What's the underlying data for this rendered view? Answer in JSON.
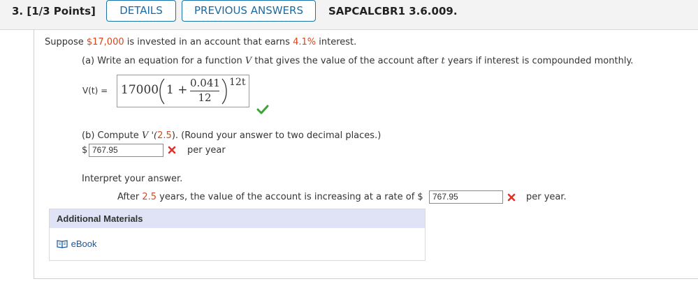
{
  "header": {
    "question_label": "3. [1/3 Points]",
    "details_button": "DETAILS",
    "previous_answers_button": "PREVIOUS ANSWERS",
    "problem_code": "SAPCALCBR1 3.6.009."
  },
  "problem": {
    "intro_before": "Suppose ",
    "intro_amount": "$17,000",
    "intro_middle": " is invested in an account that earns ",
    "intro_rate": "4.1%",
    "intro_after": " interest."
  },
  "part_a": {
    "prompt_before": "(a) Write an equation for a function ",
    "prompt_var": "V",
    "prompt_middle": " that gives the value of the account after ",
    "prompt_t": "t",
    "prompt_after": " years if interest is compounded monthly.",
    "lhs": "V(t) =",
    "formula": {
      "coefficient": "17000",
      "one_plus": "1 +",
      "numerator": "0.041",
      "denominator": "12",
      "exponent": "12t"
    },
    "status": "correct"
  },
  "part_b": {
    "prompt_before": "(b) Compute ",
    "prompt_fn": "V '(",
    "prompt_value": "2.5",
    "prompt_after": "). (Round your answer to two decimal places.)",
    "currency": "$",
    "answer": "767.95",
    "unit": "per year",
    "status": "incorrect"
  },
  "interpret": {
    "label": "Interpret your answer.",
    "sentence_before": "After ",
    "sentence_value": "2.5",
    "sentence_middle": " years, the value of the account is increasing at a rate of $",
    "answer": "767.95",
    "unit": "per year.",
    "status": "incorrect"
  },
  "additional_materials": {
    "heading": "Additional Materials",
    "ebook_label": "eBook"
  },
  "colors": {
    "highlight": "#d9461a",
    "link": "#1a6aa6",
    "correct": "#3aa535",
    "incorrect": "#e0322a"
  }
}
